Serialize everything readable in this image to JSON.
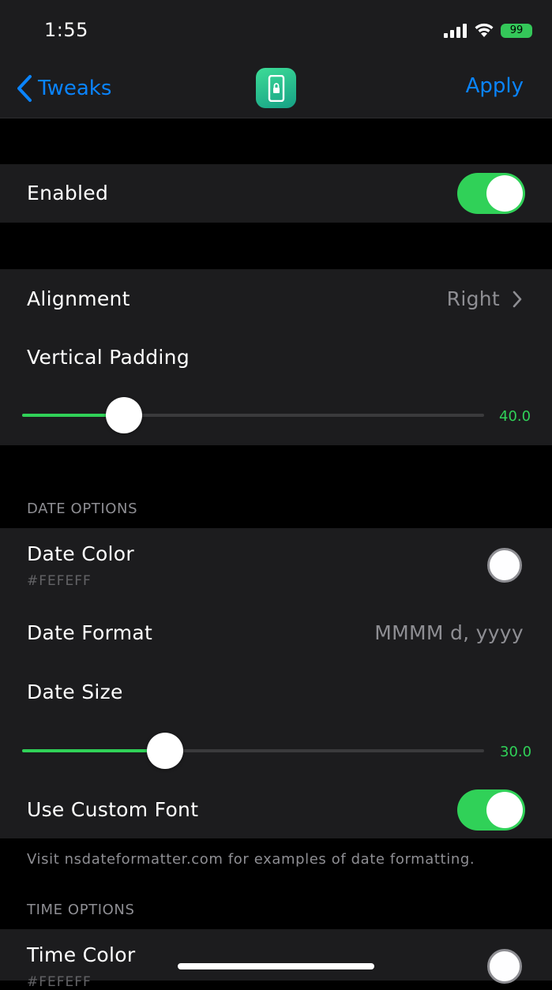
{
  "status_bar": {
    "time": "1:55",
    "battery": "99"
  },
  "nav": {
    "back_label": "Tweaks",
    "apply_label": "Apply"
  },
  "enabled": {
    "label": "Enabled",
    "on": true
  },
  "alignment": {
    "label": "Alignment",
    "value": "Right"
  },
  "vertical_padding": {
    "label": "Vertical Padding",
    "value": "40.0",
    "fraction": 0.22
  },
  "date_options": {
    "header": "DATE OPTIONS",
    "color": {
      "label": "Date Color",
      "hex": "#FEFEFF"
    },
    "format": {
      "label": "Date Format",
      "value": "MMMM d, yyyy"
    },
    "size": {
      "label": "Date Size",
      "value": "30.0",
      "fraction": 0.31
    },
    "custom_font": {
      "label": "Use Custom Font",
      "on": true
    },
    "footer": "Visit nsdateformatter.com for examples of date formatting."
  },
  "time_options": {
    "header": "TIME OPTIONS",
    "color": {
      "label": "Time Color",
      "hex": "#FEFEFF"
    }
  },
  "colors": {
    "accent": "#30d158",
    "link": "#0a84ff",
    "cell": "#1c1c1e"
  }
}
